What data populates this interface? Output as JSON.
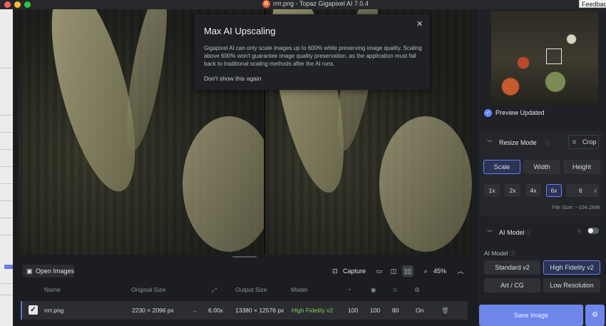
{
  "window": {
    "title": "rrrr.png - Topaz Gigapixel AI 7.0.4",
    "feedback_label": "Feedback"
  },
  "modal": {
    "title": "Max AI Upscaling",
    "body": "Gigapixel AI can only scale images up to 600% while preserving image quality. Scaling above 600% won't guarantee image quality preservation, as the application must fall back to traditional scaling methods after the AI runs.",
    "dont_show": "Don't show this again",
    "close_glyph": "✕"
  },
  "toolbar": {
    "open_images": "Open Images",
    "capture": "Capture",
    "zoom": "45%"
  },
  "table": {
    "headers": {
      "name": "Name",
      "original_size": "Original Size",
      "output_size": "Output Size",
      "model": "Model"
    },
    "row": {
      "name": "rrrr.png",
      "original_size": "2230 × 2096 px",
      "scale": "6.00x",
      "output_size": "13380 × 12576 px",
      "model": "High Fidelity v2",
      "val1": "100",
      "val2": "100",
      "val3": "80",
      "val4": "On"
    }
  },
  "sidebar": {
    "preview_status": "Preview Updated",
    "resize_mode": {
      "title": "Resize Mode",
      "crop": "Crop",
      "options": [
        "Scale",
        "Width",
        "Height"
      ],
      "selected": "Scale",
      "scales": [
        "1x",
        "2x",
        "4x",
        "6x"
      ],
      "selected_scale": "6x",
      "custom_value": "6",
      "custom_unit": "x",
      "file_size": "File Size: ~104.2MB"
    },
    "ai_model": {
      "title": "AI Model",
      "label": "AI Model",
      "models": [
        "Standard v2",
        "High Fidelity v2",
        "Art / CG",
        "Low Resolution"
      ],
      "selected": "High Fidelity v2"
    },
    "save_label": "Save Image"
  },
  "colors": {
    "accent": "#6d86ea",
    "model_green": "#7ecf5a",
    "bg": "#1b1d21"
  }
}
